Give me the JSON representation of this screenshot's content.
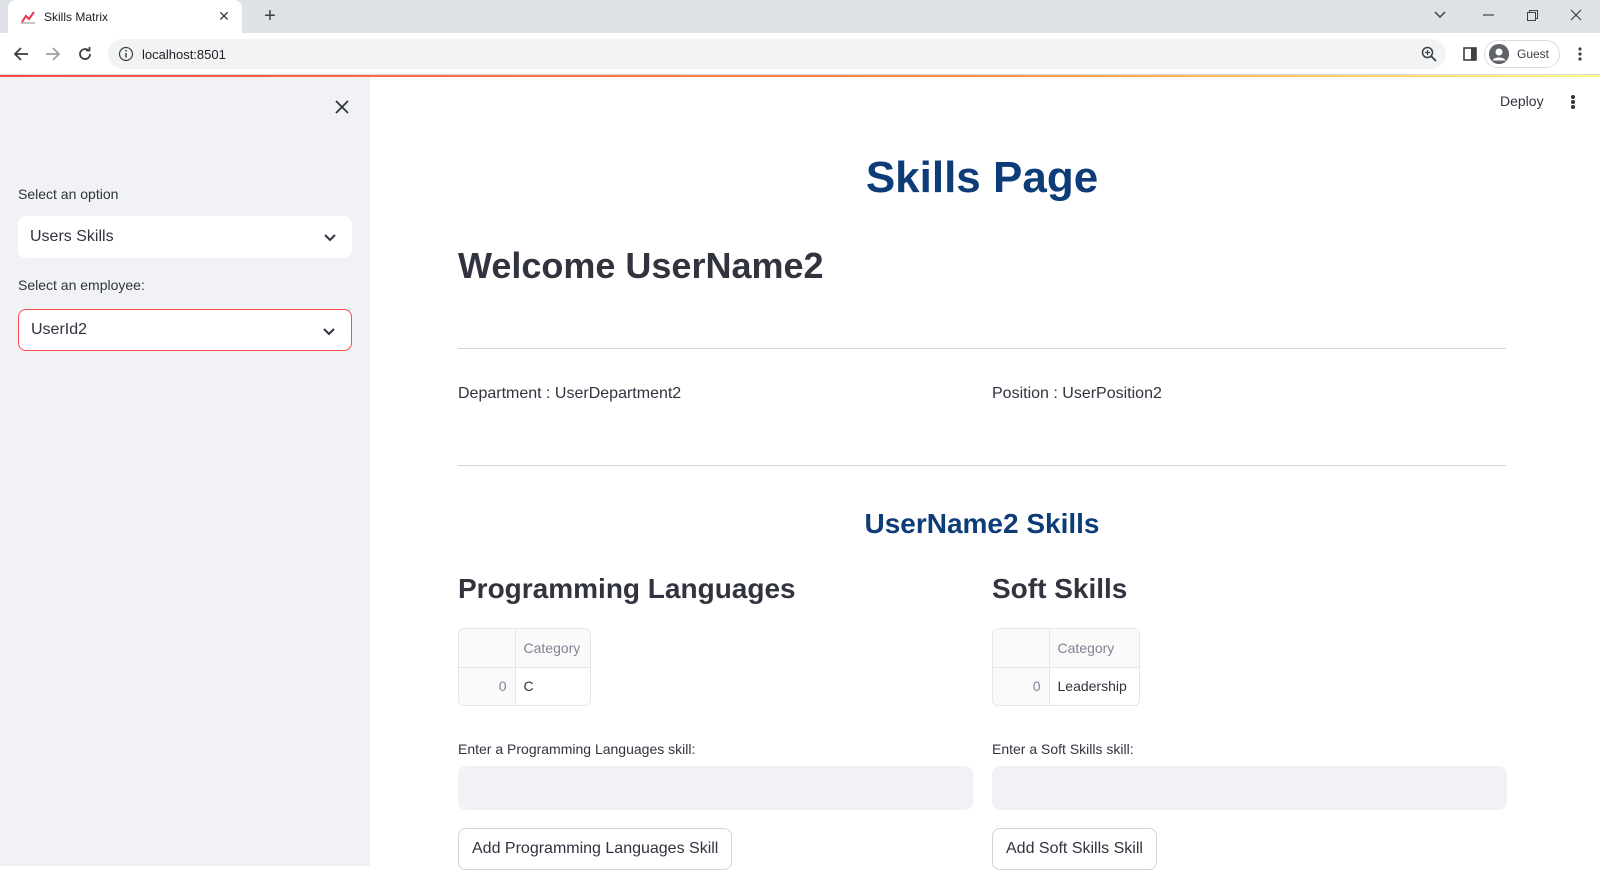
{
  "browser": {
    "tab_title": "Skills Matrix",
    "url": "localhost:8501",
    "profile_label": "Guest"
  },
  "sidebar": {
    "option_label": "Select an option",
    "option_value": "Users Skills",
    "employee_label": "Select an employee:",
    "employee_value": "UserId2"
  },
  "header": {
    "deploy_label": "Deploy"
  },
  "main": {
    "page_title": "Skills Page",
    "welcome": "Welcome UserName2",
    "department": "Department : UserDepartment2",
    "position": "Position : UserPosition2",
    "skills_title": "UserName2 Skills",
    "programming": {
      "heading": "Programming Languages",
      "table_header": "Category",
      "rows": [
        {
          "index": "0",
          "value": "C"
        }
      ],
      "input_label": "Enter a Programming Languages skill:",
      "input_value": "",
      "button_label": "Add Programming Languages Skill"
    },
    "soft": {
      "heading": "Soft Skills",
      "table_header": "Category",
      "rows": [
        {
          "index": "0",
          "value": "Leadership"
        }
      ],
      "input_label": "Enter a Soft Skills skill:",
      "input_value": "",
      "button_label": "Add Soft Skills Skill"
    }
  },
  "colors": {
    "accent": "#ff4b4b",
    "title_blue": "#0d3c78",
    "sidebar_bg": "#f0f2f6"
  }
}
